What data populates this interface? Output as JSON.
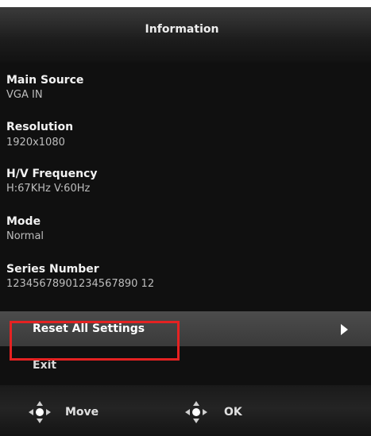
{
  "menu": {
    "title": "Information"
  },
  "info": [
    {
      "label": "Main Source",
      "value": "VGA IN"
    },
    {
      "label": "Resolution",
      "value": "1920x1080"
    },
    {
      "label": "H/V Frequency",
      "value": "H:67KHz  V:60Hz"
    },
    {
      "label": "Mode",
      "value": "Normal"
    },
    {
      "label": "Series Number",
      "value": "12345678901234567890 12"
    }
  ],
  "actions": {
    "reset_label": "Reset All Settings",
    "exit_label": "Exit"
  },
  "footer": {
    "move_label": "Move",
    "ok_label": "OK",
    "move_icon": "joystick-icon",
    "ok_icon": "joystick-icon"
  },
  "colors": {
    "background": "#101010",
    "highlight": "#e52222",
    "selected_row": "#444444"
  }
}
